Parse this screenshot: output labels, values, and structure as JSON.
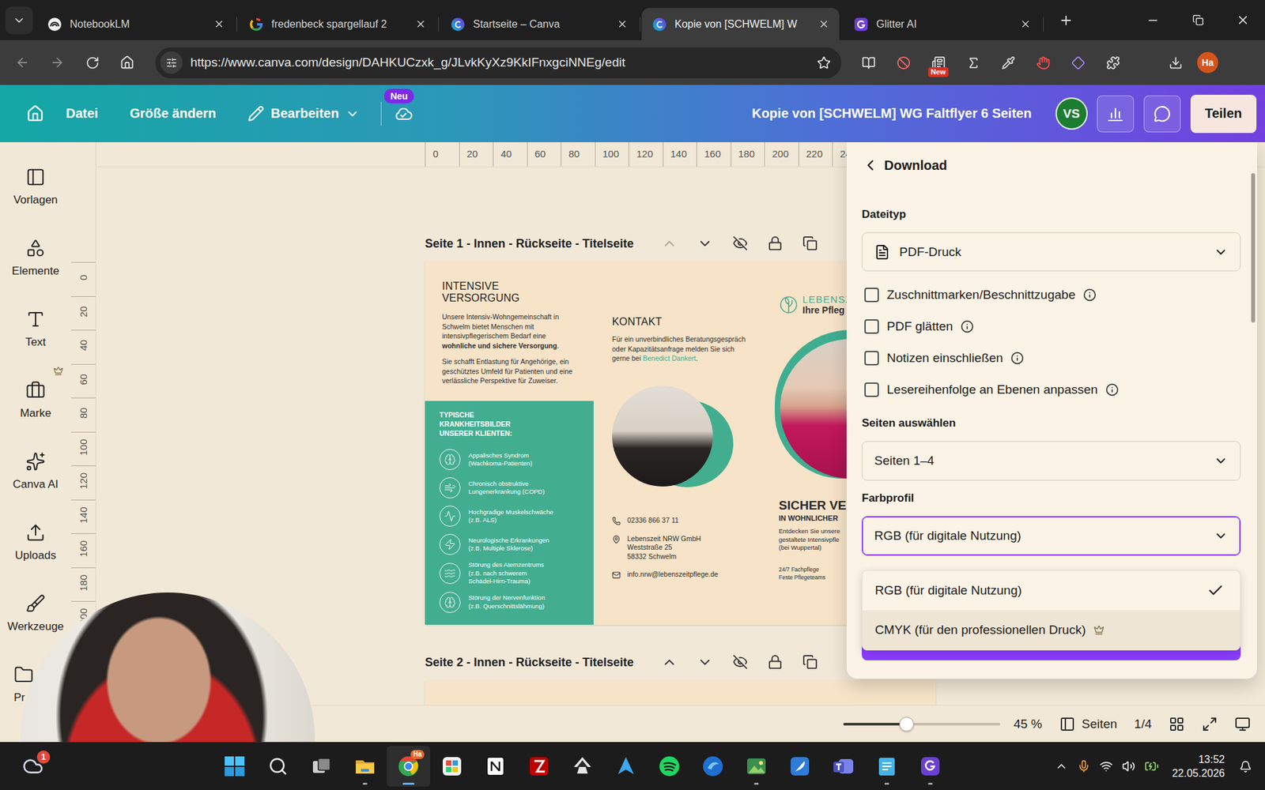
{
  "browser": {
    "tabs": [
      {
        "title": "NotebookLM",
        "selected": false,
        "kind": "notebook"
      },
      {
        "title": "fredenbeck spargellauf 2",
        "selected": false,
        "kind": "google"
      },
      {
        "title": "Startseite – Canva",
        "selected": false,
        "kind": "canva"
      },
      {
        "title": "Kopie von [SCHWELM] W",
        "selected": true,
        "kind": "canva"
      },
      {
        "title": "Glitter AI",
        "selected": false,
        "kind": "glitter"
      }
    ],
    "url": "https://www.canva.com/design/DAHKUCzxk_g/JLvkKyXz9KkIFnxgciNNEg/edit",
    "bookmarked": false,
    "extension_badge": "New",
    "profile": "Ha"
  },
  "editor_header": {
    "menu": [
      {
        "label": "Datei",
        "kind": "plain"
      },
      {
        "label": "Größe ändern",
        "kind": "plain"
      },
      {
        "label": "Bearbeiten",
        "kind": "dropdown"
      }
    ],
    "badge": "Neu",
    "title": "Kopie von [SCHWELM] WG Faltflyer 6 Seiten",
    "avatar": "VS",
    "share": "Teilen"
  },
  "sidebar": {
    "items": [
      {
        "label": "Vorlagen",
        "premium": false,
        "kind": "templates"
      },
      {
        "label": "Elemente",
        "premium": false,
        "kind": "elements"
      },
      {
        "label": "Text",
        "premium": false,
        "kind": "text"
      },
      {
        "label": "Marke",
        "premium": true,
        "kind": "brand"
      },
      {
        "label": "Canva AI",
        "premium": false,
        "kind": "ai"
      },
      {
        "label": "Uploads",
        "premium": false,
        "kind": "uploads"
      },
      {
        "label": "Werkzeuge",
        "premium": false,
        "kind": "tools"
      },
      {
        "label": "Pr",
        "premium": false,
        "kind": "projects"
      }
    ]
  },
  "rulers": {
    "top": [
      "0",
      "20",
      "40",
      "60",
      "80",
      "100",
      "120",
      "140",
      "160",
      "180",
      "200",
      "220",
      "24"
    ],
    "left": [
      "0",
      "20",
      "40",
      "60",
      "80",
      "100",
      "120",
      "140",
      "160",
      "180",
      "200"
    ]
  },
  "pages": [
    {
      "title": "Seite 1 - Innen - Rückseite - Titelseite",
      "can_move_up": false
    },
    {
      "title": "Seite 2 - Innen - Rückseite - Titelseite",
      "can_move_up": true
    }
  ],
  "flyer": {
    "heading": "INTENSIVE VERSORGUNG",
    "intro": [
      {
        "text": "Unsere Intensiv-Wohngemeinschaft in Schwelm bietet Menschen mit intensivpflegerischem Bedarf eine ",
        "bold": false
      },
      {
        "text": "wohnliche und sichere Versorgung",
        "bold": true
      },
      {
        "text": ".",
        "bold": false
      }
    ],
    "intro2": "Sie schafft Entlastung für Angehörige, ein geschütztes Umfeld für Patienten und eine verlässliche Perspektive für Zuweiser.",
    "conditions_title": "TYPISCHE KRANKHEITSBILDER UNSERER KLIENTEN:",
    "conditions": [
      {
        "lines": [
          "Appalisches Syndrom",
          "(Wachkoma-Patienten)"
        ]
      },
      {
        "lines": [
          "Chronisch obstruktive",
          "Lungenerkrankung (COPD)"
        ]
      },
      {
        "lines": [
          "Hochgradige Muskelschwäche",
          "(z.B. ALS)"
        ]
      },
      {
        "lines": [
          "Neurologische Erkrankungen",
          "(z.B. Multiple Sklerose)"
        ]
      },
      {
        "lines": [
          "Störung des Atemzentrums",
          "(z.B. nach schwerem",
          "Schädel-Hirn-Trauma)"
        ]
      },
      {
        "lines": [
          "Störung der Nervenfunktion",
          "(z.B. Querschnittslähmung)"
        ]
      }
    ],
    "contact_title": "KONTAKT",
    "contact_text": "Für ein unverbindliches Beratungsgespräch oder Kapazitätsanfrage melden Sie sich gerne bei ",
    "contact_name": "Benedict Dankert",
    "contact_end": ".",
    "phone": "02336 866 37 11",
    "address": [
      "Lebenszeit NRW GmbH",
      "Weststraße 25",
      "58332 Schwelm"
    ],
    "email": "info.nrw@lebenszeitpflege.de",
    "logo_top": "LEBENSZ",
    "logo_bottom": "Ihre Pfleg",
    "headline": "SICHER VE",
    "subheadline": "IN WOHNLICHER",
    "teaser": [
      "Entdecken Sie unsere",
      "gestaltete Intensivpfle",
      "(bei Wuppertal)"
    ],
    "features": [
      "24/7 Fachpflege",
      "Feste Pflegeteams"
    ]
  },
  "download_panel": {
    "title": "Download",
    "file_type_label": "Dateityp",
    "file_type": "PDF-Druck",
    "options": [
      {
        "label": "Zuschnittmarken/Beschnittzugabe",
        "checked": false
      },
      {
        "label": "PDF glätten",
        "checked": false
      },
      {
        "label": "Notizen einschließen",
        "checked": false
      },
      {
        "label": "Lesereihenfolge an Ebenen anpassen",
        "checked": false
      }
    ],
    "pages_label": "Seiten auswählen",
    "pages": "Seiten 1–4",
    "color_profile_label": "Farbprofil",
    "color_profile": "RGB (für digitale Nutzung)",
    "color_profile_open": true,
    "color_profile_options": [
      {
        "label": "RGB (für digitale Nutzung)",
        "selected": true,
        "premium": false,
        "hovered": false
      },
      {
        "label": "CMYK (für den professionellen Druck)",
        "selected": false,
        "premium": true,
        "hovered": true
      }
    ]
  },
  "bottom_bar": {
    "zoom_level": 0.4,
    "zoom": "45 %",
    "pages_label": "Seiten",
    "page_count": "1/4"
  },
  "taskbar": {
    "weather_badge": "1",
    "apps": [
      {
        "kind": "start",
        "running": false,
        "active": false
      },
      {
        "kind": "search",
        "running": false,
        "active": false
      },
      {
        "kind": "taskview",
        "running": false,
        "active": false
      },
      {
        "kind": "files",
        "running": true,
        "active": false
      },
      {
        "kind": "chrome",
        "running": true,
        "active": true,
        "badge": "Ha"
      },
      {
        "kind": "snip",
        "running": false,
        "active": false
      },
      {
        "kind": "notion",
        "running": false,
        "active": false
      },
      {
        "kind": "filezilla",
        "running": false,
        "active": false
      },
      {
        "kind": "inkscape",
        "running": false,
        "active": false
      },
      {
        "kind": "arrow",
        "running": false,
        "active": false
      },
      {
        "kind": "spotify",
        "running": false,
        "active": false
      },
      {
        "kind": "bird",
        "running": false,
        "active": false
      },
      {
        "kind": "photos",
        "running": true,
        "active": false
      },
      {
        "kind": "feather",
        "running": false,
        "active": false
      },
      {
        "kind": "teams",
        "running": false,
        "active": false
      },
      {
        "kind": "notepad",
        "running": true,
        "active": false
      },
      {
        "kind": "glitter",
        "running": true,
        "active": false
      }
    ],
    "time": "13:52",
    "date": "22.05.2026"
  }
}
